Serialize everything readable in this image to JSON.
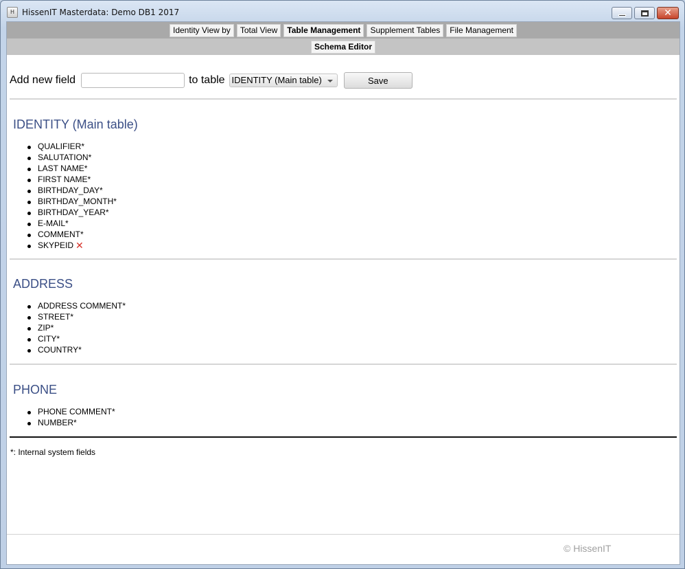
{
  "window": {
    "title": "HissenIT Masterdata: Demo DB1 2017",
    "app_icon_glyph": "H",
    "controls": {
      "minimize_icon": "minimize-icon",
      "maximize_icon": "maximize-icon",
      "close_icon": "close-icon",
      "close_glyph": "✕"
    }
  },
  "nav": {
    "tabs": [
      {
        "label": "Identity View by",
        "active": false
      },
      {
        "label": "Total View",
        "active": false
      },
      {
        "label": "Table Management",
        "active": true
      },
      {
        "label": "Supplement Tables",
        "active": false
      },
      {
        "label": "File Management",
        "active": false
      }
    ],
    "subtabs": [
      {
        "label": "Schema Editor",
        "active": true
      }
    ]
  },
  "toolbar": {
    "add_label": "Add new field",
    "field_value": "",
    "to_table_label": "to table",
    "table_select_value": "IDENTITY (Main table)",
    "save_label": "Save"
  },
  "sections": [
    {
      "title": "IDENTITY (Main table)",
      "fields": [
        {
          "name": "QUALIFIER*",
          "deletable": false
        },
        {
          "name": "SALUTATION*",
          "deletable": false
        },
        {
          "name": "LAST NAME*",
          "deletable": false
        },
        {
          "name": "FIRST NAME*",
          "deletable": false
        },
        {
          "name": "BIRTHDAY_DAY*",
          "deletable": false
        },
        {
          "name": "BIRTHDAY_MONTH*",
          "deletable": false
        },
        {
          "name": "BIRTHDAY_YEAR*",
          "deletable": false
        },
        {
          "name": "E-MAIL*",
          "deletable": false
        },
        {
          "name": "COMMENT*",
          "deletable": false
        },
        {
          "name": "SKYPEID",
          "deletable": true
        }
      ]
    },
    {
      "title": "ADDRESS",
      "fields": [
        {
          "name": "ADDRESS COMMENT*",
          "deletable": false
        },
        {
          "name": "STREET*",
          "deletable": false
        },
        {
          "name": "ZIP*",
          "deletable": false
        },
        {
          "name": "CITY*",
          "deletable": false
        },
        {
          "name": "COUNTRY*",
          "deletable": false
        }
      ]
    },
    {
      "title": "PHONE",
      "fields": [
        {
          "name": "PHONE COMMENT*",
          "deletable": false
        },
        {
          "name": "NUMBER*",
          "deletable": false
        }
      ]
    }
  ],
  "delete_glyph": "✕",
  "footnote": "*: Internal system fields",
  "copyright": "© HissenIT",
  "colors": {
    "section_title": "#3b4f86",
    "delete_icon": "#d6332a",
    "nav_bar": "#a9a9a9",
    "subnav_bar": "#c4c4c4"
  }
}
